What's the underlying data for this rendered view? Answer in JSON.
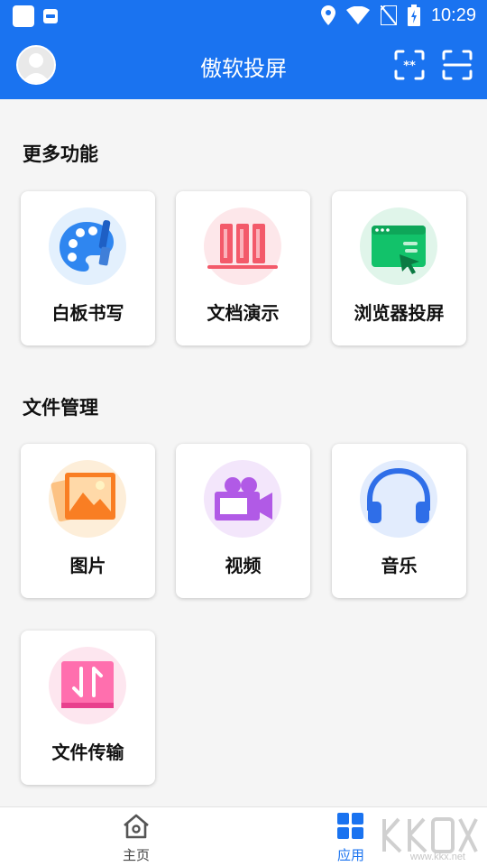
{
  "status_bar": {
    "time": "10:29"
  },
  "header": {
    "title": "傲软投屏"
  },
  "sections": [
    {
      "title": "更多功能"
    },
    {
      "title": "文件管理"
    }
  ],
  "cards": {
    "whiteboard": "白板书写",
    "document": "文档演示",
    "browser": "浏览器投屏",
    "picture": "图片",
    "video": "视频",
    "music": "音乐",
    "transfer": "文件传输"
  },
  "nav": {
    "home": "主页",
    "apps": "应用"
  },
  "watermark": {
    "text": "www.kkx.net"
  },
  "colors": {
    "primary": "#1a73f0"
  },
  "icons": [
    "avatar-icon",
    "screen-code-icon",
    "scan-icon",
    "palette-icon",
    "books-icon",
    "browser-cast-icon",
    "image-icon",
    "video-camera-icon",
    "headphones-icon",
    "transfer-icon",
    "home-icon",
    "apps-grid-icon"
  ]
}
